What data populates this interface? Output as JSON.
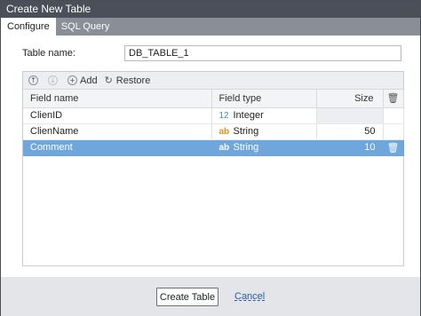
{
  "window": {
    "title": "Create New Table"
  },
  "tabs": [
    {
      "label": "Configure",
      "active": true
    },
    {
      "label": "SQL Query",
      "active": false
    }
  ],
  "form": {
    "table_name_label": "Table name:",
    "table_name_value": "DB_TABLE_1"
  },
  "toolbar": {
    "up_icon": "↑",
    "down_icon": "↓",
    "add_icon": "+",
    "add_label": "Add",
    "restore_icon": "↻",
    "restore_label": "Restore"
  },
  "columns": {
    "field_name": "Field name",
    "field_type": "Field type",
    "size": "Size",
    "delete_icon": "🗑"
  },
  "rows": [
    {
      "name": "ClienID",
      "type_icon": "12",
      "type": "Integer",
      "size": "",
      "selected": false
    },
    {
      "name": "ClienName",
      "type_icon": "ab",
      "type": "String",
      "size": "50",
      "selected": false
    },
    {
      "name": "Comment",
      "type_icon": "ab",
      "type": "String",
      "size": "10",
      "selected": true
    }
  ],
  "footer": {
    "create_label": "Create Table",
    "cancel_label": "Cancel"
  },
  "colors": {
    "titlebar": "#4b4f59",
    "tabbar": "#8a8e96",
    "selection": "#6fa7dc",
    "footer": "#e4e5e8"
  }
}
